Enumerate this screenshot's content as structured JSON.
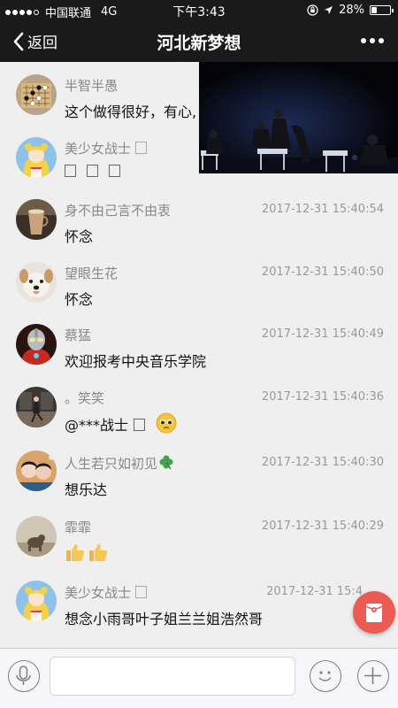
{
  "status_bar": {
    "carrier": "中国联通",
    "network": "4G",
    "time": "下午3:43",
    "battery": "28%",
    "battery_level": 0.28
  },
  "nav": {
    "back_label": "返回",
    "title": "河北新梦想"
  },
  "comments": [
    {
      "name": "半智半愚",
      "time": "",
      "text": "这个做得很好，有心,",
      "avatar": "go-board-icon"
    },
    {
      "name": "美少女战士",
      "time": "",
      "text": "",
      "avatar": "sailor-moon-icon"
    },
    {
      "name": "身不由己言不由衷",
      "time": "2017-12-31 15:40:54",
      "text": "怀念",
      "avatar": "coffee-cup-icon"
    },
    {
      "name": "望眼生花",
      "time": "2017-12-31 15:40:50",
      "text": "怀念",
      "avatar": "dog-icon"
    },
    {
      "name": "蔡猛",
      "time": "2017-12-31 15:40:49",
      "text": "欢迎报考中央音乐学院",
      "avatar": "ultraman-icon"
    },
    {
      "name": "。笑笑",
      "time": "2017-12-31 15:40:36",
      "text": "@***战士",
      "avatar": "dance-studio-icon"
    },
    {
      "name": "人生若只如初见",
      "time": "2017-12-31 15:40:30",
      "text": "想乐达",
      "avatar": "couple-photo-icon"
    },
    {
      "name": "霏霏",
      "time": "2017-12-31 15:40:29",
      "text": "",
      "avatar": "dog-on-floor-icon"
    },
    {
      "name": "美少女战士",
      "time": "2017-12-31 15:4",
      "text": "想念小雨哥叶子姐兰兰姐浩然哥",
      "avatar": "sailor-moon-icon"
    }
  ],
  "input": {
    "placeholder": ""
  },
  "colors": {
    "bar_background": "#1a1a1a",
    "float_button": "#ec5b53",
    "list_background": "#efeff0"
  }
}
